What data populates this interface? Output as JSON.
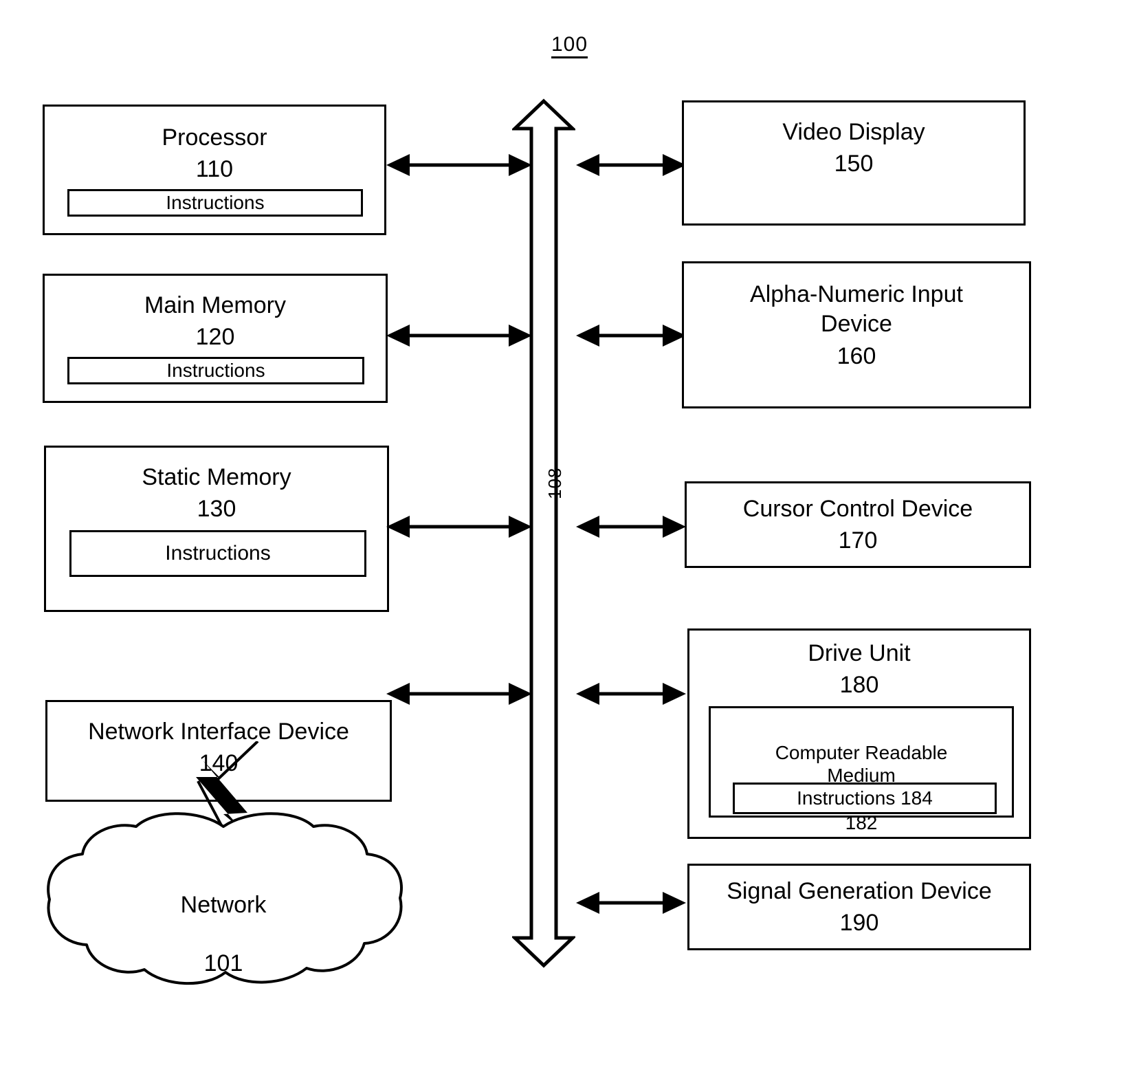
{
  "figure": {
    "title": "100",
    "bus_label": "108"
  },
  "left_column": {
    "blocks": [
      {
        "name": "processor",
        "label": "Processor",
        "number": "110",
        "sub_label": "Instructions"
      },
      {
        "name": "main-memory",
        "label": "Main Memory",
        "number": "120",
        "sub_label": "Instructions"
      },
      {
        "name": "static-memory",
        "label": "Static Memory",
        "number": "130",
        "sub_label": "Instructions"
      },
      {
        "name": "network-interface-device",
        "label": "Network Interface Device",
        "number": "140"
      }
    ],
    "network": {
      "label": "Network",
      "number": "101"
    }
  },
  "right_column": {
    "blocks": [
      {
        "name": "video-display",
        "label": "Video Display",
        "number": "150"
      },
      {
        "name": "alpha-numeric-input-device",
        "label": "Alpha-Numeric Input\nDevice",
        "number": "160"
      },
      {
        "name": "cursor-control-device",
        "label": "Cursor Control Device",
        "number": "170"
      },
      {
        "name": "drive-unit",
        "label": "Drive Unit",
        "number": "180",
        "medium_label": "Computer Readable\nMedium",
        "medium_number": "182",
        "instructions_label": "Instructions 184"
      },
      {
        "name": "signal-generation-device",
        "label": "Signal Generation Device",
        "number": "190"
      }
    ]
  },
  "colors": {
    "ink": "#000000",
    "paper": "#ffffff"
  }
}
